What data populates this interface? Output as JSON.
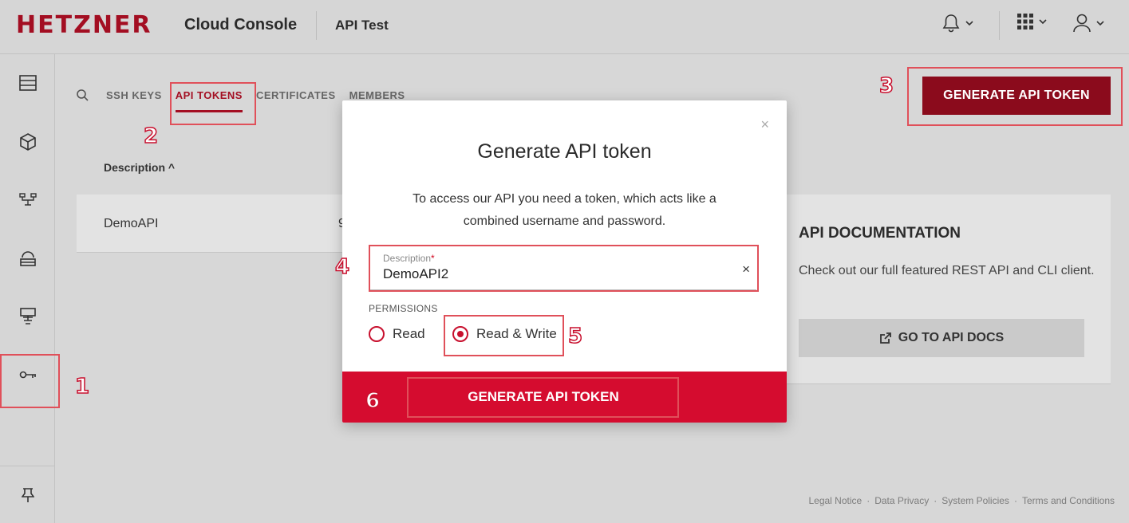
{
  "header": {
    "logo": "HETZNER",
    "console_title": "Cloud Console",
    "project": "API Test"
  },
  "icons": {
    "notification": "bell-icon",
    "apps": "grid-icon",
    "user": "user-icon",
    "chevron": "chevron-down-icon"
  },
  "sidebar": {
    "items": [
      {
        "name": "servers-icon"
      },
      {
        "name": "volumes-icon"
      },
      {
        "name": "networks-icon"
      },
      {
        "name": "load-balancers-icon"
      },
      {
        "name": "firewalls-icon"
      },
      {
        "name": "security-key-icon"
      }
    ],
    "bottom": "pin-icon"
  },
  "tabs": [
    {
      "label": "SSH KEYS",
      "active": false
    },
    {
      "label": "API TOKENS",
      "active": true
    },
    {
      "label": "CERTIFICATES",
      "active": false
    },
    {
      "label": "MEMBERS",
      "active": false
    }
  ],
  "table": {
    "column": "Description ^",
    "rows": [
      {
        "description": "DemoAPI",
        "partial": "9"
      }
    ]
  },
  "top_button": "GENERATE API TOKEN",
  "docs": {
    "title": "API DOCUMENTATION",
    "text": "Check out our full featured REST API and CLI client.",
    "button": "GO TO API DOCS"
  },
  "footer": {
    "links": [
      "Legal Notice",
      "Data Privacy",
      "System Policies",
      "Terms and Conditions"
    ],
    "separator": "·"
  },
  "modal": {
    "close": "×",
    "title": "Generate API token",
    "text": "To access our API you need a token, which acts like a combined username and password.",
    "field_label": "Description",
    "field_required": "*",
    "field_value": "DemoAPI2",
    "field_clear": "×",
    "permissions_label": "PERMISSIONS",
    "options": [
      {
        "label": "Read",
        "selected": false
      },
      {
        "label": "Read & Write",
        "selected": true
      }
    ],
    "submit": "GENERATE API TOKEN"
  },
  "annotations": [
    "1",
    "2",
    "3",
    "4",
    "5",
    "6"
  ],
  "colors": {
    "brand": "#a30e22",
    "accent": "#d50c2f",
    "annotation": "#e0505a"
  }
}
